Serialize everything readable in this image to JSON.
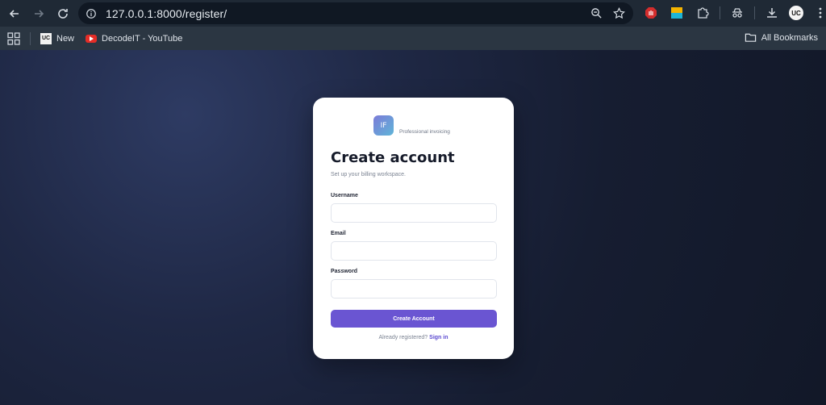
{
  "browser": {
    "url": "127.0.0.1:8000/register/",
    "bookmarks": [
      {
        "label": "New",
        "icon": "uc-favicon"
      },
      {
        "label": "DecodeIT - YouTube",
        "icon": "youtube-favicon"
      }
    ],
    "all_bookmarks_label": "All Bookmarks",
    "profile_initials": "UC"
  },
  "brand": {
    "logo_text": "IF",
    "tagline": "Professional invoicing"
  },
  "form": {
    "title": "Create account",
    "subtitle": "Set up your billing workspace.",
    "username_label": "Username",
    "username_value": "",
    "email_label": "Email",
    "email_value": "",
    "password_label": "Password",
    "password_value": "",
    "submit_label": "Create Account",
    "footer_text": "Already registered?",
    "signin_label": "Sign in"
  },
  "colors": {
    "accent": "#6a55d2",
    "background": "#161d31",
    "card": "#ffffff"
  }
}
